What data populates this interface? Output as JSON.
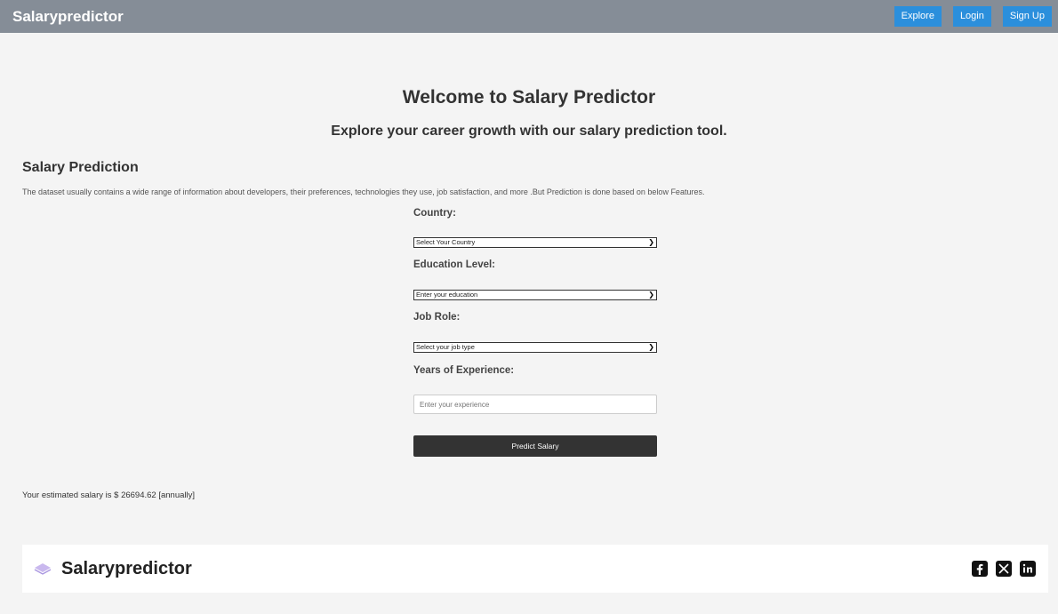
{
  "navbar": {
    "brand": "Salarypredictor",
    "links": [
      "Explore",
      "Login",
      "Sign Up"
    ]
  },
  "hero": {
    "title": "Welcome to Salary Predictor",
    "subtitle": "Explore your career growth with our salary prediction tool."
  },
  "section": {
    "title": "Salary Prediction",
    "description": "The dataset usually contains a wide range of information about developers, their preferences, technologies they use, job satisfaction, and more .But Prediction is done based on below Features."
  },
  "form": {
    "country_label": "Country:",
    "country_value": "Select Your Country",
    "education_label": "Education Level:",
    "education_value": "Enter your education",
    "job_label": "Job Role:",
    "job_value": "Select your job type",
    "experience_label": "Years of Experience:",
    "experience_placeholder": "Enter your experience",
    "submit_label": "Predict Salary"
  },
  "result": "Your estimated salary is $ 26694.62 [annually]",
  "footer": {
    "brand": "Salarypredictor",
    "socials": [
      "facebook-icon",
      "x-icon",
      "linkedin-icon"
    ]
  },
  "colors": {
    "navbar": "#858d97",
    "nav_button": "#2b8fdc",
    "predict_button": "#333333",
    "background": "#f4f4f4"
  }
}
